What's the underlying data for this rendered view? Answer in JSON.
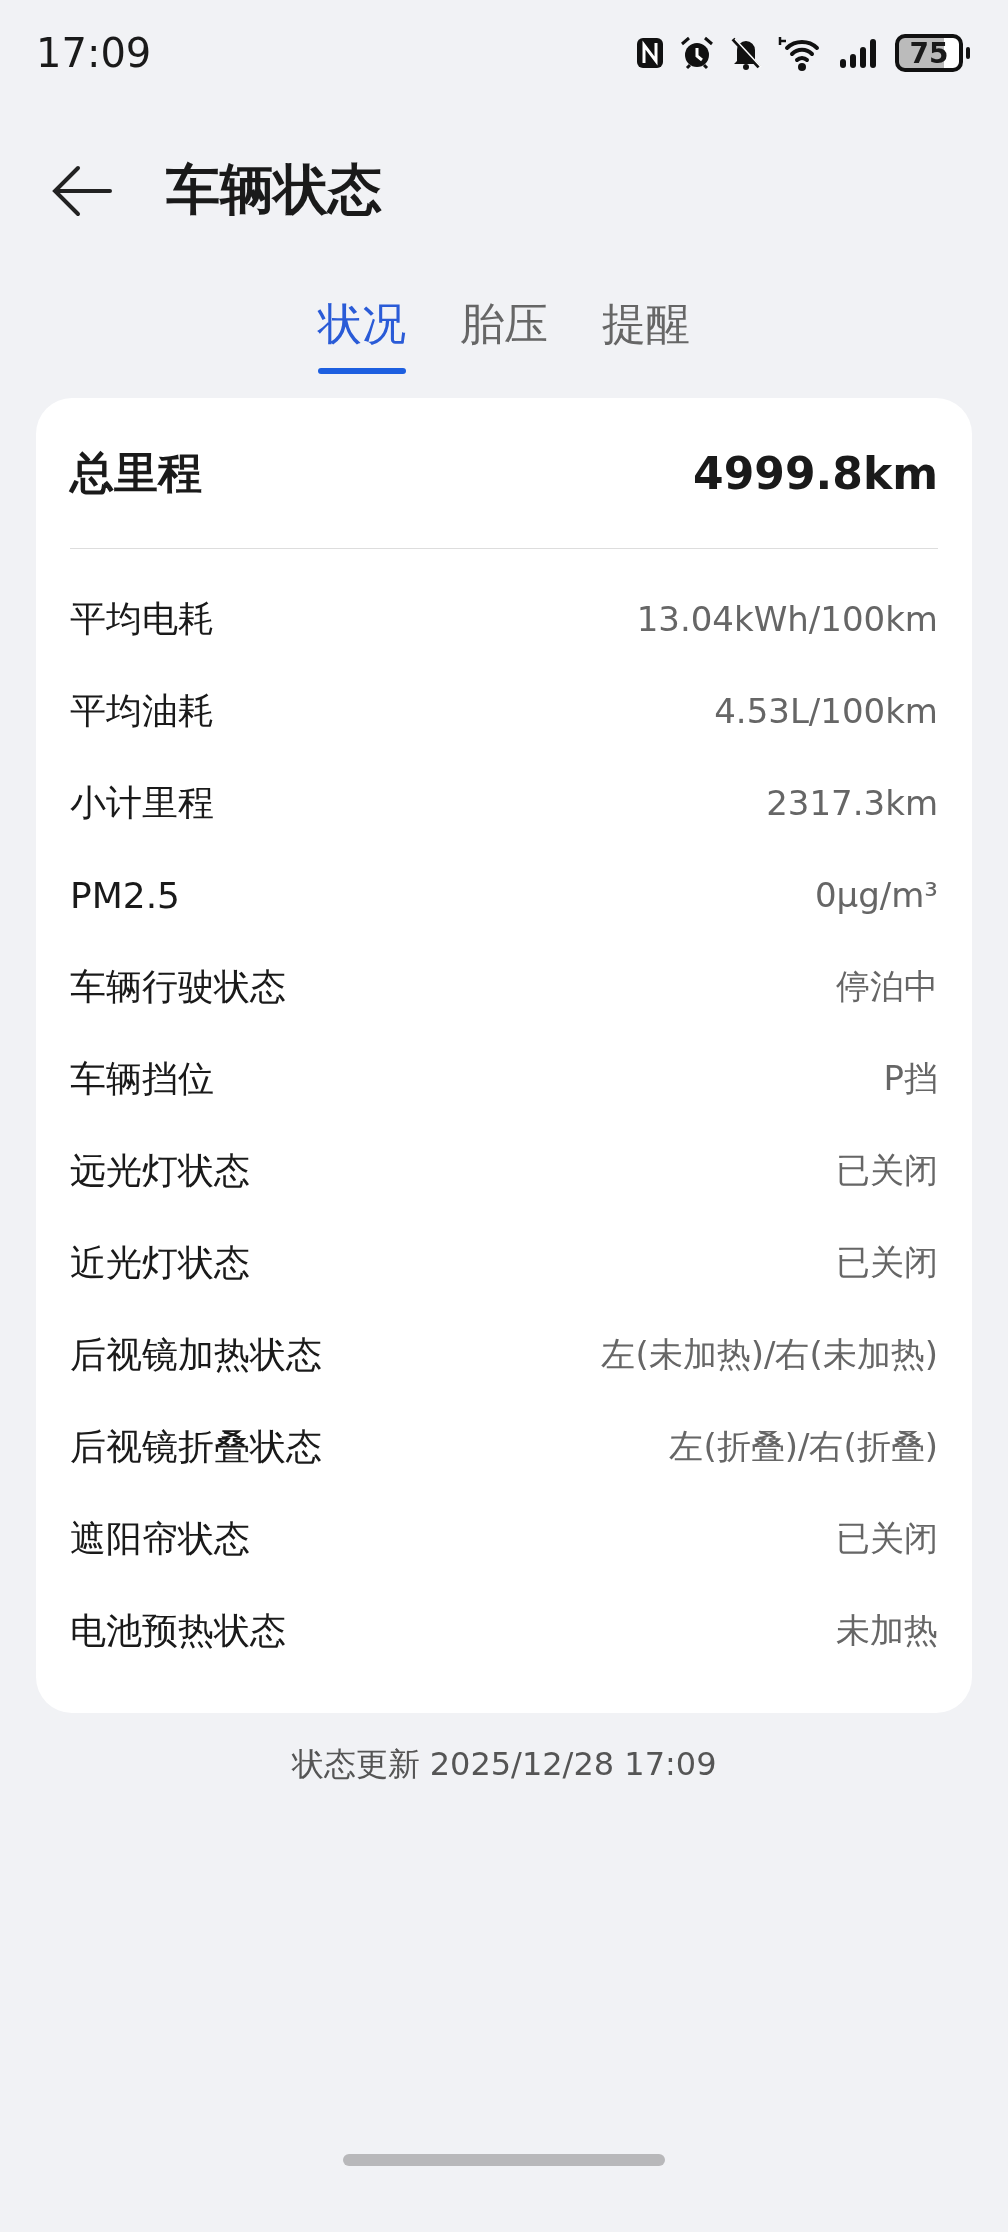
{
  "status_bar": {
    "time": "17:09",
    "battery": "75"
  },
  "header": {
    "title": "车辆状态"
  },
  "tabs": [
    {
      "label": "状况",
      "selected": true
    },
    {
      "label": "胎压",
      "selected": false
    },
    {
      "label": "提醒",
      "selected": false
    }
  ],
  "summary": {
    "label": "总里程",
    "value": "4999.8km"
  },
  "rows": [
    {
      "label": "平均电耗",
      "value": "13.04kWh/100km"
    },
    {
      "label": "平均油耗",
      "value": "4.53L/100km"
    },
    {
      "label": "小计里程",
      "value": "2317.3km"
    },
    {
      "label": "PM2.5",
      "value": "0μg/m³"
    },
    {
      "label": "车辆行驶状态",
      "value": "停泊中"
    },
    {
      "label": "车辆挡位",
      "value": "P挡"
    },
    {
      "label": "远光灯状态",
      "value": "已关闭"
    },
    {
      "label": "近光灯状态",
      "value": "已关闭"
    },
    {
      "label": "后视镜加热状态",
      "value": "左(未加热)/右(未加热)"
    },
    {
      "label": "后视镜折叠状态",
      "value": "左(折叠)/右(折叠)"
    },
    {
      "label": "遮阳帘状态",
      "value": "已关闭"
    },
    {
      "label": "电池预热状态",
      "value": "未加热"
    }
  ],
  "footer": "状态更新 2025/12/28 17:09"
}
